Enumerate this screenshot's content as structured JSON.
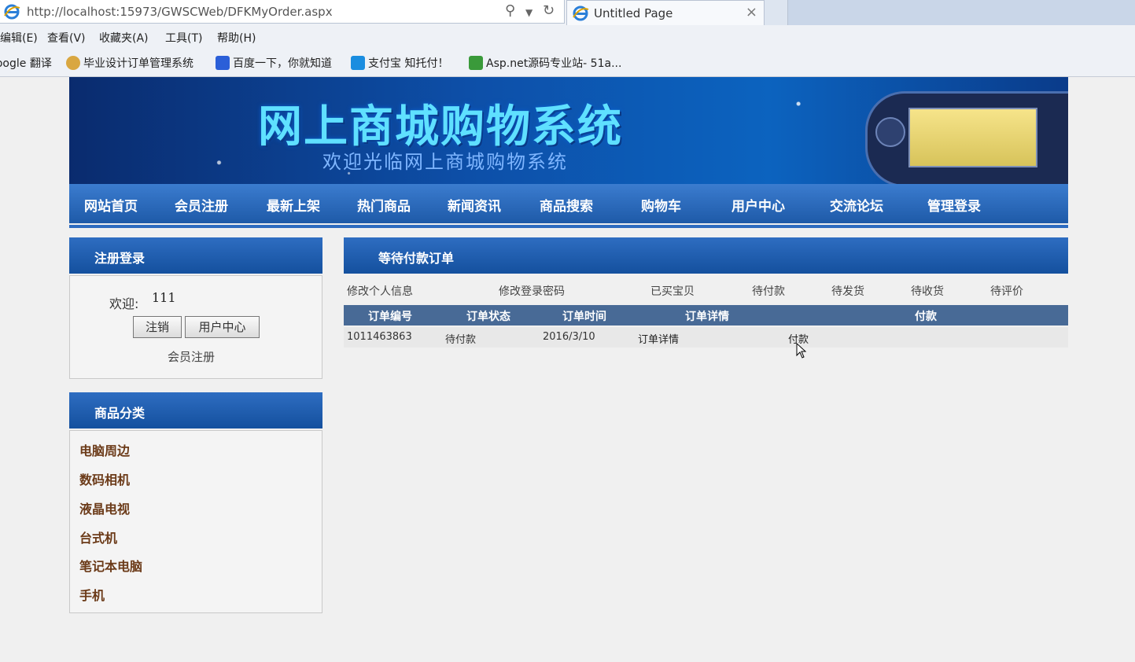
{
  "browser": {
    "url": "http://localhost:15973/GWSCWeb/DFKMyOrder.aspx",
    "tab_title": "Untitled Page",
    "menu": [
      "编辑(E)",
      "查看(V)",
      "收藏夹(A)",
      "工具(T)",
      "帮助(H)"
    ],
    "favorites": [
      "Google 翻译",
      "毕业设计订单管理系统",
      "百度一下，你就知道",
      "支付宝 知托付！",
      "Asp.net源码专业站- 51a..."
    ]
  },
  "banner": {
    "title": "网上商城购物系统",
    "subtitle": "欢迎光临网上商城购物系统"
  },
  "nav": [
    "网站首页",
    "会员注册",
    "最新上架",
    "热门商品",
    "新闻资讯",
    "商品搜索",
    "购物车",
    "用户中心",
    "交流论坛",
    "管理登录"
  ],
  "login": {
    "heading": "注册登录",
    "welcome_label": "欢迎:",
    "username": "111",
    "logout_label": "注销",
    "user_center_label": "用户中心",
    "register_link": "会员注册"
  },
  "categories": {
    "heading": "商品分类",
    "items": [
      "电脑周边",
      "数码相机",
      "液晶电视",
      "台式机",
      "笔记本电脑",
      "手机"
    ]
  },
  "orders": {
    "heading": "等待付款订单",
    "subnav": [
      "修改个人信息",
      "修改登录密码",
      "已买宝贝",
      "待付款",
      "待发货",
      "待收货",
      "待评价"
    ],
    "columns": [
      "订单编号",
      "订单状态",
      "订单时间",
      "订单详情",
      "付款"
    ],
    "rows": [
      {
        "id": "1011463863",
        "status": "待付款",
        "time": "2016/3/10",
        "detail": "订单详情",
        "pay": "付款"
      }
    ]
  },
  "colors": {
    "nav_blue": "#1e5aa8",
    "table_header": "#486a96",
    "category_text": "#6b3a18"
  }
}
